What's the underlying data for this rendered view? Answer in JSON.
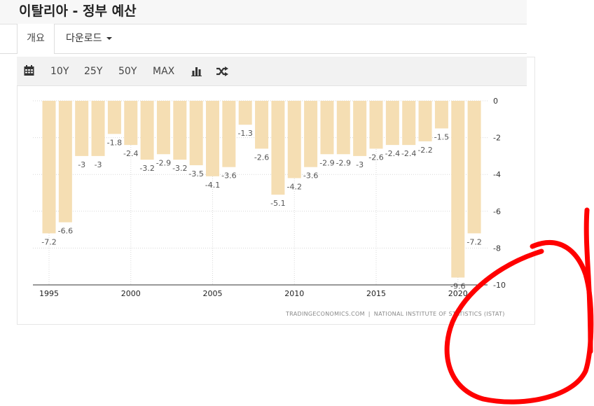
{
  "page": {
    "title": "이탈리아 - 정부 예산"
  },
  "tabs": {
    "overview_label": "개요",
    "download_label": "다운로드"
  },
  "toolbar": {
    "items": [
      {
        "label": "10Y"
      },
      {
        "label": "25Y"
      },
      {
        "label": "50Y"
      },
      {
        "label": "MAX"
      }
    ],
    "icons": [
      "calendar-icon",
      "bar-chart-icon",
      "shuffle-icon"
    ]
  },
  "source": {
    "site": "TRADINGECONOMICS.COM",
    "divider": "|",
    "provider": "NATIONAL INSTITUTE OF STATISTICS (ISTAT)"
  },
  "colors": {
    "bar": "#f5deb3",
    "annotation": "#ff0000"
  },
  "chart_data": {
    "type": "bar",
    "categories": [
      "1995",
      "1996",
      "1997",
      "1998",
      "1999",
      "2000",
      "2001",
      "2002",
      "2003",
      "2004",
      "2005",
      "2006",
      "2007",
      "2008",
      "2009",
      "2010",
      "2011",
      "2012",
      "2013",
      "2014",
      "2015",
      "2016",
      "2017",
      "2018",
      "2019",
      "2020",
      "2021"
    ],
    "values": [
      -7.2,
      -6.6,
      -3,
      -3,
      -1.8,
      -2.4,
      -3.2,
      -2.9,
      -3.2,
      -3.5,
      -4.1,
      -3.6,
      -1.3,
      -2.6,
      -5.1,
      -4.2,
      -3.6,
      -2.9,
      -2.9,
      -3,
      -2.6,
      -2.4,
      -2.4,
      -2.2,
      -1.5,
      -9.6,
      -7.2
    ],
    "data_labels": [
      "-7.2",
      "-6.6",
      "-3",
      "-3",
      "-1.8",
      "-2.4",
      "-3.2",
      "-2.9",
      "-3.2",
      "-3.5",
      "-4.1",
      "-3.6",
      "-1.3",
      "-2.6",
      "-5.1",
      "-4.2",
      "-3.6",
      "-2.9",
      "-2.9",
      "-3",
      "-2.6",
      "-2.4",
      "-2.4",
      "-2.2",
      "-1.5",
      "-9.6",
      "-7.2"
    ],
    "x_ticks": [
      "1995",
      "2000",
      "2005",
      "2010",
      "2015",
      "2020"
    ],
    "y_ticks": [
      "0",
      "-2",
      "-4",
      "-6",
      "-8",
      "-10"
    ],
    "ylim": [
      -10,
      0
    ],
    "y_axis_side": "right",
    "grid": true,
    "title": "",
    "xlabel": "",
    "ylabel": ""
  }
}
